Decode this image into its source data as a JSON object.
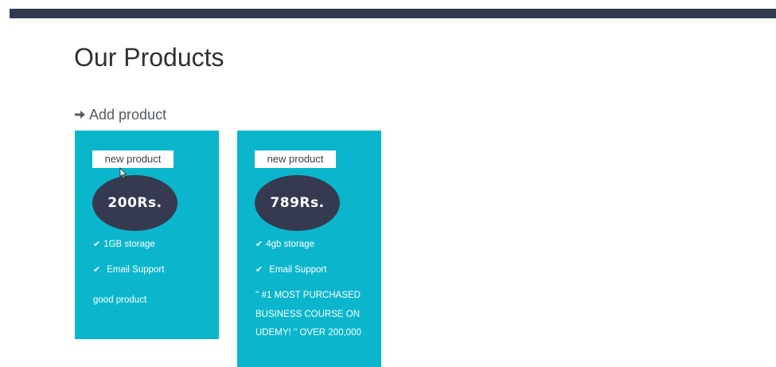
{
  "header": {
    "title": "Our Products"
  },
  "actions": {
    "add_product_label": "Add product"
  },
  "products": [
    {
      "badge": "new product",
      "price": "200Rs.",
      "features": [
        "1GB storage",
        "Email Support"
      ],
      "description": "good product"
    },
    {
      "badge": "new product",
      "price": "789Rs.",
      "features": [
        "4gb storage",
        "Email Support"
      ],
      "description": "'' #1 MOST PURCHASED BUSINESS COURSE ON UDEMY! '' OVER 200,000"
    }
  ],
  "colors": {
    "top_bar": "#343a4f",
    "card_bg": "#0bb6cd",
    "price_oval": "#353a50",
    "badge_bg": "#ffffff",
    "title_text": "#2f3133"
  },
  "icons": {
    "add": "arrow-right-icon",
    "feature": "check-icon"
  }
}
